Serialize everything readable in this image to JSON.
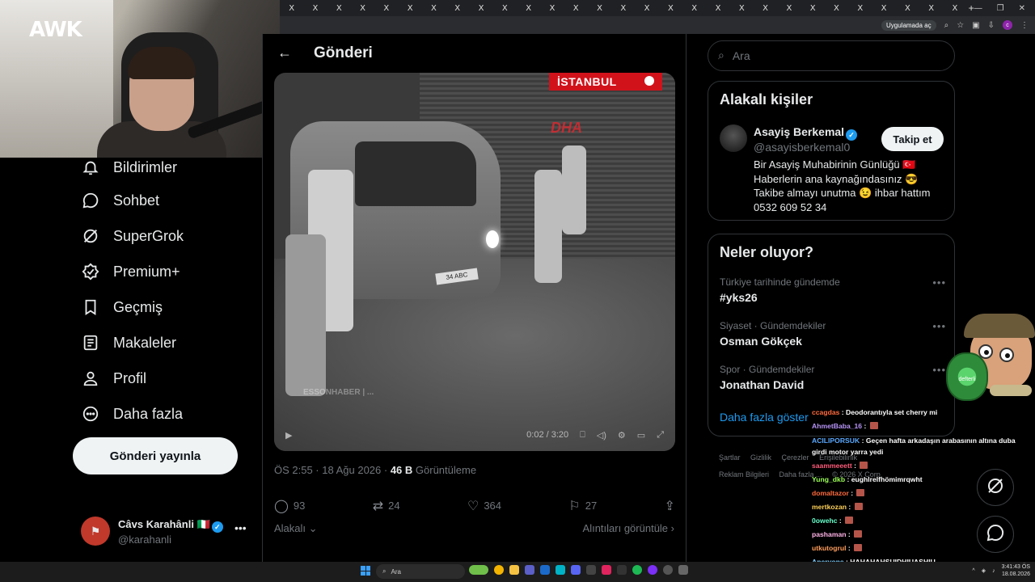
{
  "browser": {
    "tabs": [
      "X",
      "X",
      "X",
      "X",
      "X",
      "X",
      "X",
      "X",
      "X",
      "X",
      "X",
      "X",
      "X",
      "X",
      "X",
      "X",
      "X",
      "X",
      "X",
      "X",
      "X",
      "X",
      "X",
      "X",
      "X",
      "X",
      "X",
      "X",
      "X"
    ],
    "tab_plus": "+",
    "open_in_app": "Uygulamada aç"
  },
  "webcam": {
    "logo": "AWK"
  },
  "nav": {
    "items": [
      {
        "label": "Bildirimler",
        "icon": "bell-icon"
      },
      {
        "label": "Sohbet",
        "icon": "chat-bubble-icon"
      },
      {
        "label": "SuperGrok",
        "icon": "grok-icon"
      },
      {
        "label": "Premium+",
        "icon": "verified-badge-icon"
      },
      {
        "label": "Geçmiş",
        "icon": "bookmark-icon"
      },
      {
        "label": "Makaleler",
        "icon": "article-icon"
      },
      {
        "label": "Profil",
        "icon": "person-icon"
      },
      {
        "label": "Daha fazla",
        "icon": "more-circle-icon"
      }
    ],
    "post_button": "Gönderi yayınla",
    "account": {
      "name": "Câvs Karahânli 🇮🇹",
      "handle": "@karahanli",
      "more": "•••"
    }
  },
  "post": {
    "header_title": "Gönderi",
    "video": {
      "location_badge": "İSTANBUL",
      "agency": "DHA",
      "watermark": "ESSONHABER | ...",
      "plate": "34 ABC",
      "time": "0:02 / 3:20"
    },
    "timestamp": "ÖS 2:55 · 18 Ağu 2026 · ",
    "views_count": "46 B",
    "views_label": " Görüntüleme",
    "replies": "93",
    "reposts": "24",
    "likes": "364",
    "bookmarks": "27",
    "sort_label": "Alakalı",
    "quotes_label": "Alıntıları görüntüle"
  },
  "sidebar": {
    "search_placeholder": "Ara",
    "related": {
      "title": "Alakalı kişiler",
      "name": "Asayiş Berkemal",
      "handle": "@asayisberkemal0",
      "follow_label": "Takip et",
      "bio": "Bir Asayiş Muhabirinin Günlüğü 🇹🇷 Haberlerin ana kaynağındasınız 😎 Takibe almayı unutma 😉 ihbar hattım 0532 609 52 34"
    },
    "trending": {
      "title": "Neler oluyor?",
      "items": [
        {
          "meta": "Türkiye tarihinde gündemde",
          "name": "#yks26"
        },
        {
          "meta": "Siyaset · Gündemdekiler",
          "name": "Osman Gökçek"
        },
        {
          "meta": "Spor · Gündemdekiler",
          "name": "Jonathan David"
        }
      ],
      "show_more": "Daha fazla göster"
    },
    "footer": [
      "Şartlar",
      "Gizlilik",
      "Çerezler",
      "Erişilebilirlik",
      "Reklam Bilgileri",
      "Daha fazla ...",
      "© 2026 X Corp."
    ]
  },
  "chat": {
    "messages": [
      {
        "user": "ccagdas",
        "color": "#ff6a3d",
        "text": "Deodorantıyla set cherry mi"
      },
      {
        "user": "AhmetBaba_16",
        "color": "#b794f6",
        "text": ""
      },
      {
        "user": "ACILIPORSUK",
        "color": "#5aa9ff",
        "text": "Geçen hafta arkadaşın arabasının altına duba girdi motor yarra yedi"
      },
      {
        "user": "saammeeett",
        "color": "#ff5c7a",
        "text": ""
      },
      {
        "user": "Yung_dkb",
        "color": "#9cff57",
        "text": "eughlrelfhömimrqwht"
      },
      {
        "user": "domaltazor",
        "color": "#ff6a3d",
        "text": ""
      },
      {
        "user": "mertkozan",
        "color": "#ffd25a",
        "text": ""
      },
      {
        "user": "0owehc",
        "color": "#66ffcc",
        "text": ""
      },
      {
        "user": "pashaman",
        "color": "#ffb3e6",
        "text": ""
      },
      {
        "user": "utkutogrul",
        "color": "#ff9d5c",
        "text": ""
      },
      {
        "user": "Aperyone",
        "color": "#7fd0ff",
        "text": "HAHAHAHSUIDHIUASHIU"
      }
    ]
  },
  "mascot": {
    "label": "defterli"
  },
  "taskbar": {
    "search_label": "Ara",
    "time": "3:41:43 ÖS",
    "date": "18.08.2026"
  },
  "colors": {
    "accent": "#1d9bf0",
    "badge_red": "#d1121b"
  }
}
